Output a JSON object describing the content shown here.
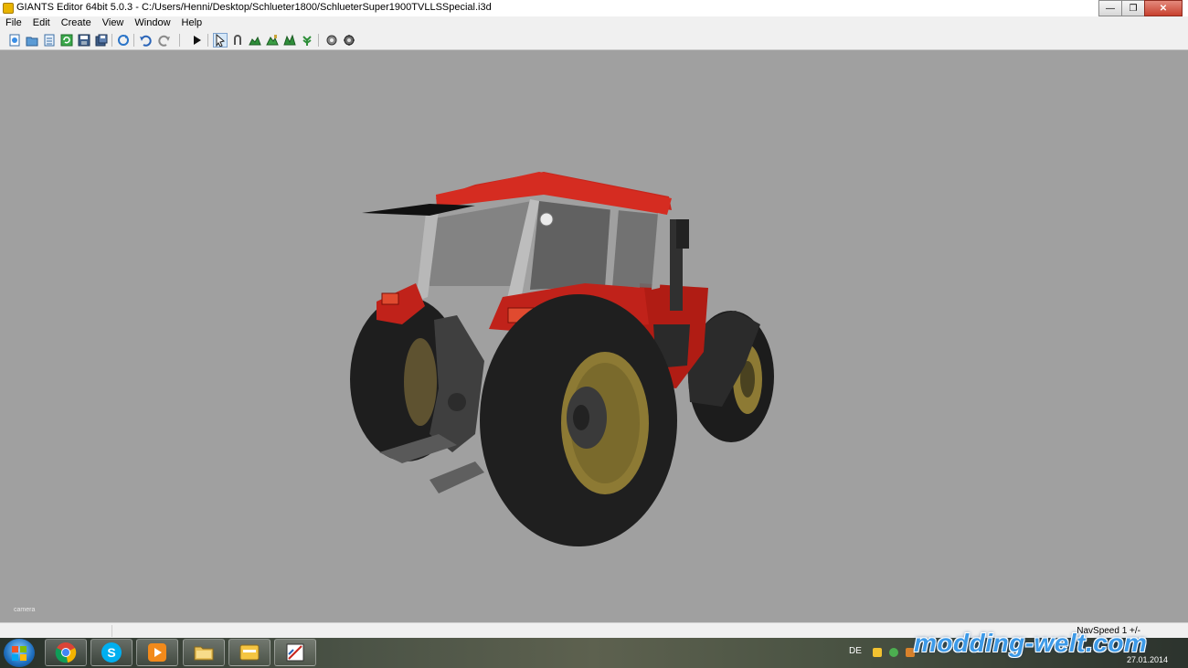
{
  "window": {
    "title": "GIANTS Editor 64bit 5.0.3 - C:/Users/Henni/Desktop/Schlueter1800/SchlueterSuper1900TVLLSSpecial.i3d"
  },
  "menu": {
    "items": [
      {
        "label": "File"
      },
      {
        "label": "Edit"
      },
      {
        "label": "Create"
      },
      {
        "label": "View"
      },
      {
        "label": "Window"
      },
      {
        "label": "Help"
      }
    ]
  },
  "toolbar": {
    "icons": [
      "new-icon",
      "open-icon",
      "import-icon",
      "reload-icon",
      "save-icon",
      "save-all-icon",
      "rotate-icon",
      "undo-icon",
      "redo-icon",
      "play-icon",
      "select-icon",
      "move-icon",
      "terrain-icon",
      "terrain-paint-icon",
      "foliage-icon",
      "plant-icon",
      "settings-icon",
      "settings-alt-icon"
    ]
  },
  "viewport": {
    "camera_label": "camera",
    "colors": {
      "background": "#a0a0a0",
      "body": "#c0221a",
      "tire": "#1d1d1d",
      "rim": "#8d7a34"
    }
  },
  "statusbar": {
    "nav_speed": "NavSpeed 1 +/-"
  },
  "taskbar": {
    "apps": [
      "windows-start-icon",
      "chrome-icon",
      "skype-icon",
      "media-player-icon",
      "file-explorer-icon",
      "folder-icon",
      "giants-editor-icon"
    ],
    "language": "DE",
    "date": "27.01.2014"
  },
  "watermark": {
    "text": "modding-welt.com"
  }
}
